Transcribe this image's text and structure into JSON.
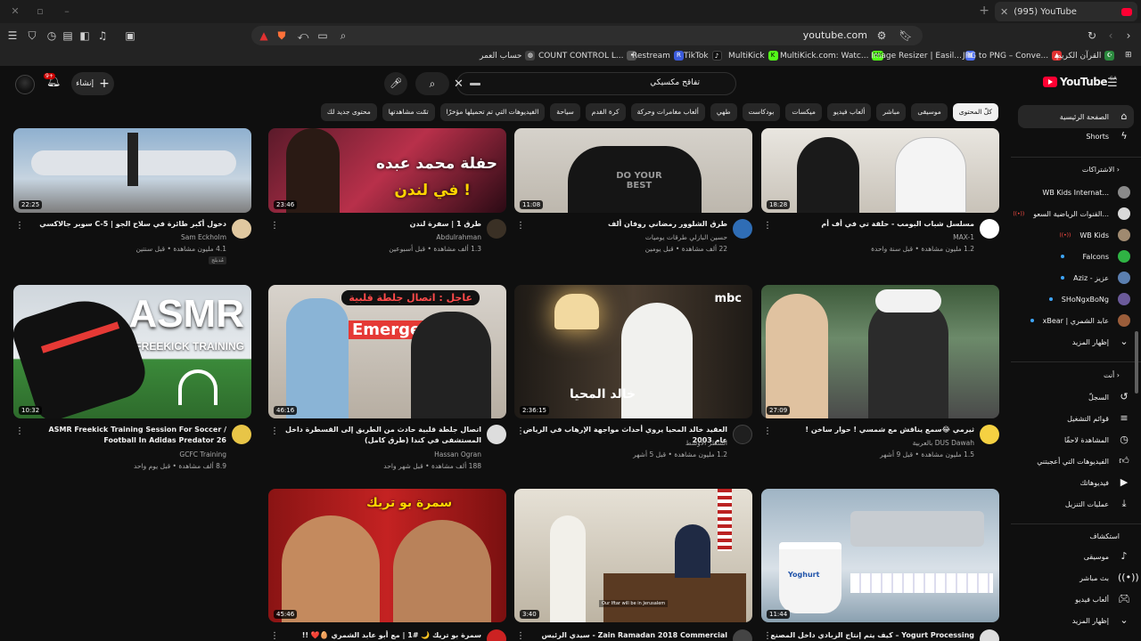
{
  "browser": {
    "tab_title": "(995) YouTube",
    "url": "youtube.com",
    "bookmarks": [
      {
        "label": "حساب العمر",
        "icon_color": "#3a3a3a",
        "icon": "globe-icon"
      },
      {
        "label": "COUNT CONTROL L...",
        "icon_color": "#555555",
        "icon": "count-icon"
      },
      {
        "label": "Restream",
        "icon_color": "#3b5bdb",
        "icon": "restream-icon",
        "glyph": "R"
      },
      {
        "label": "TikTok",
        "icon_color": "#111111",
        "icon": "tiktok-icon",
        "glyph": "♪"
      },
      {
        "label": "MultiKick",
        "icon_color": "#53fc18",
        "icon": "kick-icon",
        "glyph": "K"
      },
      {
        "label": "MultiKick.com: Watc...",
        "icon_color": "#53fc18",
        "icon": "kick-icon",
        "glyph": "MK"
      },
      {
        "label": "Image Resizer | Easil...",
        "icon_color": "#4c6ef5",
        "icon": "image-resizer-icon"
      },
      {
        "label": "JPG to PNG – Conve...",
        "icon_color": "#e03131",
        "icon": "jpg-png-icon"
      },
      {
        "label": "القرآن الكريم",
        "icon_color": "#2b8a3e",
        "icon": "quran-icon"
      }
    ]
  },
  "header": {
    "search_value": "تفاقح مكسيكي",
    "create_label": "إنشاء",
    "notification_count": "9+",
    "logo_text": "YouTube",
    "logo_country": "SA"
  },
  "chips": [
    "كلّ المحتوى",
    "موسيقى",
    "مباشر",
    "ألعاب فيديو",
    "ميكسات",
    "بودكاست",
    "طهي",
    "ألعاب مغامرات وحركة",
    "كرة القدم",
    "سياحة",
    "الفيديوهات التي تم تحميلها مؤخرًا",
    "تمّت مشاهدتها",
    "محتوى جديد لك"
  ],
  "sidebar": {
    "home": "الصفحة الرئيسية",
    "shorts": "Shorts",
    "subscriptions_head": "الاشتراكات",
    "subscriptions": [
      {
        "name": "WB Kids Internat...",
        "color": "#8a8a8a"
      },
      {
        "name": "القنوات الرياضية السعو...",
        "color": "#d9d9d9",
        "live": true
      },
      {
        "name": "WB Kids",
        "color": "#a08a70",
        "live": true
      },
      {
        "name": "Falcons",
        "color": "#2fb344"
      },
      {
        "name": "Aziz - عزيز",
        "color": "#5b7fb0"
      },
      {
        "name": "SHoNgxBoNg",
        "color": "#6b5a9a"
      },
      {
        "name": "xBear | عابد الشمري",
        "color": "#9b5d3a"
      }
    ],
    "show_more": "إظهار المزيد",
    "you_head": "أنت",
    "you_items": [
      {
        "label": "السجلّ",
        "icon": "history-icon"
      },
      {
        "label": "قوائم التشغيل",
        "icon": "playlist-icon"
      },
      {
        "label": "المشاهدة لاحقًا",
        "icon": "watch-later-icon"
      },
      {
        "label": "الفيديوهات التي أعجبتني",
        "icon": "like-icon"
      },
      {
        "label": "فيديوهاتك",
        "icon": "your-videos-icon"
      },
      {
        "label": "عمليات التنزيل",
        "icon": "download-icon"
      }
    ],
    "explore_head": "استكشاف",
    "explore_items": [
      {
        "label": "موسيقى",
        "icon": "music-icon"
      },
      {
        "label": "بث مباشر",
        "icon": "live-icon"
      },
      {
        "label": "ألعاب فيديو",
        "icon": "gaming-icon"
      },
      {
        "label": "إظهار المزيد",
        "icon": "chevron-down-icon"
      }
    ]
  },
  "videos": [
    {
      "title": "دخول أكبر طائرة في سلاح الجو | C-5 سوبر جالاكسي",
      "channel": "Sam Eckholm",
      "meta": "4.1 مليون مشاهدة • قبل سنتين",
      "duration": "22:25",
      "tag": "مُدبلج",
      "thumb": "plane"
    },
    {
      "title": "طرق 1 | سفرة لندن",
      "channel": "Abdulrahman",
      "meta": "1.3 ألف مشاهدة • قبل أسبوعين",
      "duration": "23:46",
      "thumb": "concert"
    },
    {
      "title": "طرق الشلوور رمضاني روفان ألف",
      "channel": "حسين البازلي طرقات يوميات",
      "meta": "22 ألف مشاهدة • قبل يومين",
      "duration": "11:08",
      "thumb": "shirt"
    },
    {
      "title": "مسلسل شباب البومب - حلقة تي في أف أم",
      "channel": "MAX-1",
      "meta": "1.2 مليون مشاهدة • قبل سنة واحدة",
      "duration": "18:28",
      "thumb": "podcast"
    },
    {
      "title": "ASMR Freekick Training Session For Soccer / Football In Adidas Predator 26",
      "channel": "GCFC Training",
      "meta": "8.9 ألف مشاهدة • قبل يوم واحد",
      "duration": "10:32",
      "thumb": "asmr"
    },
    {
      "title": "اتصال جلطة قلبية حادث من الطريق إلى القسطرة داخل المستشفى في كندا (طرق كامل)",
      "channel": "Hassan Ogran",
      "meta": "188 ألف مشاهدة • قبل شهر واحد",
      "duration": "46:16",
      "thumb": "hospital"
    },
    {
      "title": "العقيد خالد المحيا يروي أحداث مواجهة الإرهاب في الرياض عام 2003",
      "channel": "السطر الأوسط",
      "meta": "1.2 مليون مشاهدة • قبل 5 أشهر",
      "duration": "2:36:15",
      "thumb": "mbc"
    },
    {
      "title": "ثيرمي 😂سمع يناقش مع شمسي ! حوار ساخن !",
      "channel": "DUS Dawah بالعربية",
      "meta": "1.5 مليون مشاهدة • قبل 9 أشهر",
      "duration": "27:09",
      "thumb": "debate"
    },
    {
      "title": "سمرة بو تريك 🌙 #1 | مع أبو عابد الشمري 🥚❤️ !!",
      "channel": "",
      "meta": "",
      "duration": "45:46",
      "thumb": "laugh"
    },
    {
      "title": "Zain Ramadan 2018 Commercial - سيدي الرئيس",
      "channel": "",
      "meta": "",
      "duration": "3:40",
      "thumb": "office"
    },
    {
      "title": "Yogurt Processing – كيف يتم إنتاج الزبادي داخل المصنع",
      "channel": "",
      "meta": "",
      "duration": "11:44",
      "thumb": "factory"
    }
  ],
  "thumb_texts": {
    "asmr_big": "ASMR",
    "asmr_small": "FREEKICK TRAINING",
    "hospital_banner": "عاجل : اتصال جلطة قلبية",
    "hospital_sign": "Emergency",
    "concert_line1": "حفلة محمد عبده",
    "concert_line2": "في لندن !",
    "mbc_logo": "mbc",
    "mbc_name": "خالد المحيا",
    "laugh_text": "سمرة بو تريك",
    "office_caption": "Our Iftar will be in Jerusalem",
    "factory_label": "Yoghurt",
    "shirt_text": "DO YOUR BEST"
  }
}
